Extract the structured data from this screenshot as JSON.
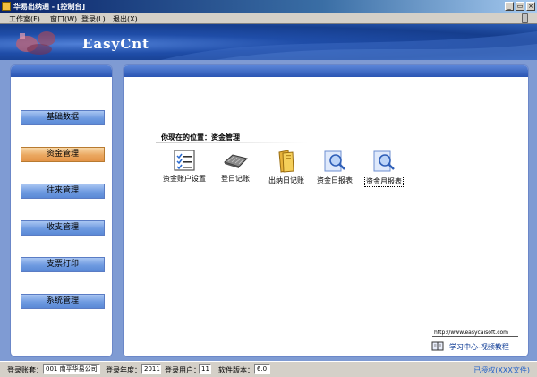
{
  "window": {
    "title": "华易出纳通 - [控制台]",
    "controls": {
      "minimize": "_",
      "restore": "▭",
      "close": "×"
    }
  },
  "menu": [
    {
      "label": "工作室(F)"
    },
    {
      "label": "窗口(W)"
    },
    {
      "label": "登录(L)"
    },
    {
      "label": "退出(X)"
    }
  ],
  "banner": {
    "brand": "EasyCnt"
  },
  "nav": {
    "items": [
      {
        "label": "基础数据",
        "active": false
      },
      {
        "label": "资金管理",
        "active": true
      },
      {
        "label": "往来管理",
        "active": false
      },
      {
        "label": "收支管理",
        "active": false
      },
      {
        "label": "支票打印",
        "active": false
      },
      {
        "label": "系统管理",
        "active": false
      }
    ]
  },
  "content": {
    "location": "你现在的位置：资金管理",
    "functions": [
      {
        "label": "资金账户设置",
        "icon": "checklist-icon"
      },
      {
        "label": "登日记账",
        "icon": "keyboard-icon"
      },
      {
        "label": "出纳日记账",
        "icon": "folder-icon"
      },
      {
        "label": "资金日报表",
        "icon": "report-search-icon"
      },
      {
        "label": "资金月报表",
        "icon": "report-search-icon"
      }
    ],
    "url": "http://www.easycaisoft.com",
    "help_link": "学习中心-视频教程"
  },
  "status": {
    "account_label": "登录账套：",
    "account_value": "001 南平华易公司",
    "year_label": "登录年度：",
    "year_value": "2011",
    "user_label": "登录用户：",
    "user_value": "11",
    "version_label": "软件版本：",
    "version_value": "6.0",
    "authorized": "已授权(XXX文件)"
  },
  "colors": {
    "accent_blue": "#2a55b3",
    "active_orange": "#eaa760",
    "nav_blue": "#6e9ae0"
  }
}
